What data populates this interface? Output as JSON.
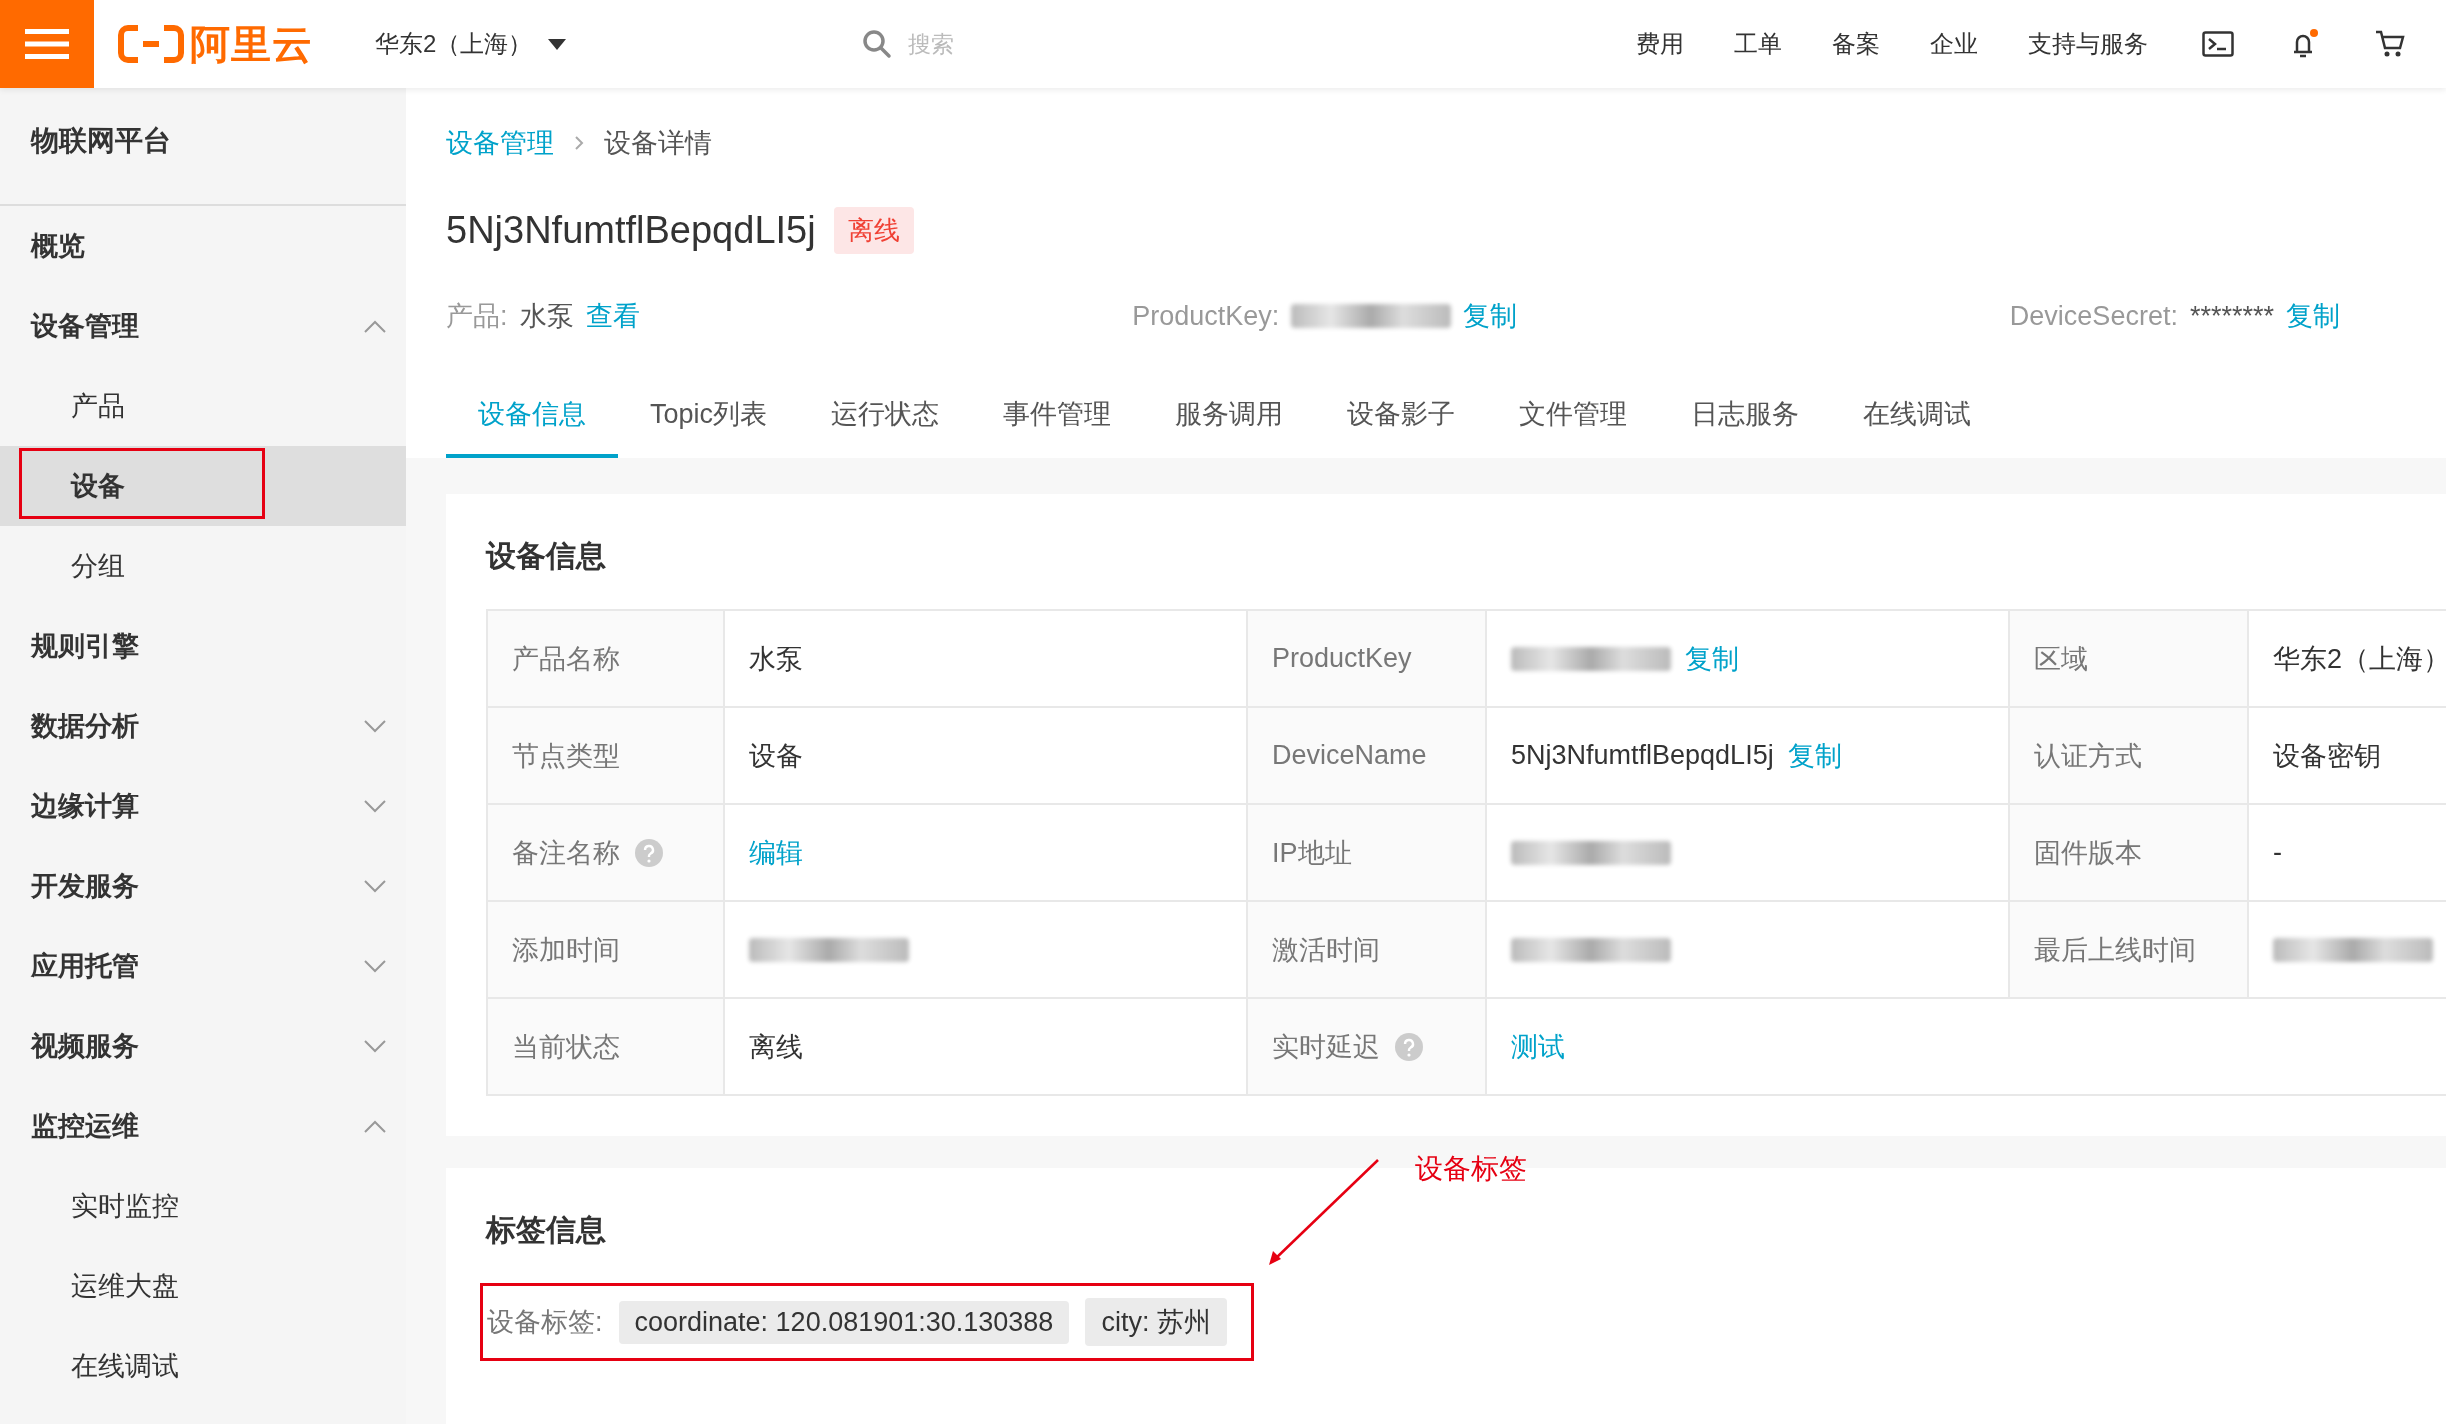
{
  "topbar": {
    "logo": "阿里云",
    "region": "华东2（上海）",
    "search_placeholder": "搜索",
    "links": [
      "费用",
      "工单",
      "备案",
      "企业",
      "支持与服务"
    ],
    "notification_dot": true
  },
  "sidebar": {
    "title": "物联网平台",
    "items": [
      {
        "label": "概览"
      },
      {
        "label": "设备管理",
        "expanded": true,
        "children": [
          {
            "label": "产品",
            "selected": false,
            "boxed": false
          },
          {
            "label": "设备",
            "selected": true,
            "boxed": true
          },
          {
            "label": "分组",
            "selected": false,
            "boxed": false
          }
        ]
      },
      {
        "label": "规则引擎"
      },
      {
        "label": "数据分析",
        "expanded": false
      },
      {
        "label": "边缘计算",
        "expanded": false
      },
      {
        "label": "开发服务",
        "expanded": false
      },
      {
        "label": "应用托管",
        "expanded": false
      },
      {
        "label": "视频服务",
        "expanded": false
      },
      {
        "label": "监控运维",
        "expanded": true,
        "children": [
          {
            "label": "实时监控",
            "selected": false,
            "boxed": false
          },
          {
            "label": "运维大盘",
            "selected": false,
            "boxed": false
          },
          {
            "label": "在线调试",
            "selected": false,
            "boxed": false
          }
        ]
      }
    ]
  },
  "breadcrumb": [
    {
      "label": "设备管理",
      "kind": "link"
    },
    {
      "label": "设备详情",
      "kind": "current"
    }
  ],
  "device": {
    "name": "5Nj3NfumtflBepqdLI5j",
    "status": "离线"
  },
  "meta": [
    {
      "label": "产品:",
      "value": "水泵",
      "action": "查看"
    },
    {
      "label": "ProductKey:",
      "redacted": true,
      "action": "复制"
    },
    {
      "label": "DeviceSecret:",
      "value": "********",
      "action": "复制"
    }
  ],
  "tabs": [
    {
      "label": "设备信息",
      "selected": true
    },
    {
      "label": "Topic列表",
      "selected": false
    },
    {
      "label": "运行状态",
      "selected": false
    },
    {
      "label": "事件管理",
      "selected": false
    },
    {
      "label": "服务调用",
      "selected": false
    },
    {
      "label": "设备影子",
      "selected": false
    },
    {
      "label": "文件管理",
      "selected": false
    },
    {
      "label": "日志服务",
      "selected": false
    },
    {
      "label": "在线调试",
      "selected": false
    }
  ],
  "info": {
    "title": "设备信息",
    "rows": [
      [
        {
          "label": "产品名称",
          "kind": "text",
          "value": "水泵"
        },
        {
          "label": "ProductKey",
          "kind": "redacted",
          "action": "复制"
        },
        {
          "label": "区域",
          "kind": "text",
          "value": "华东2（上海）"
        }
      ],
      [
        {
          "label": "节点类型",
          "kind": "text",
          "value": "设备"
        },
        {
          "label": "DeviceName",
          "kind": "text",
          "value": "5Nj3NfumtflBepqdLI5j",
          "action": "复制"
        },
        {
          "label": "认证方式",
          "kind": "text",
          "value": "设备密钥"
        }
      ],
      [
        {
          "label": "备注名称",
          "help": true,
          "kind": "link",
          "value": "编辑"
        },
        {
          "label": "IP地址",
          "kind": "redacted"
        },
        {
          "label": "固件版本",
          "kind": "text",
          "value": "-"
        }
      ],
      [
        {
          "label": "添加时间",
          "kind": "redacted"
        },
        {
          "label": "激活时间",
          "kind": "redacted"
        },
        {
          "label": "最后上线时间",
          "kind": "redacted"
        }
      ],
      [
        {
          "label": "当前状态",
          "kind": "text",
          "value": "离线"
        },
        {
          "label": "实时延迟",
          "help": true,
          "kind": "link",
          "value": "测试"
        }
      ]
    ]
  },
  "tags": {
    "title": "标签信息",
    "label": "设备标签:",
    "items": [
      "coordinate: 120.081901:30.130388",
      "city: 苏州"
    ],
    "boxed": true,
    "annotation": "设备标签"
  }
}
